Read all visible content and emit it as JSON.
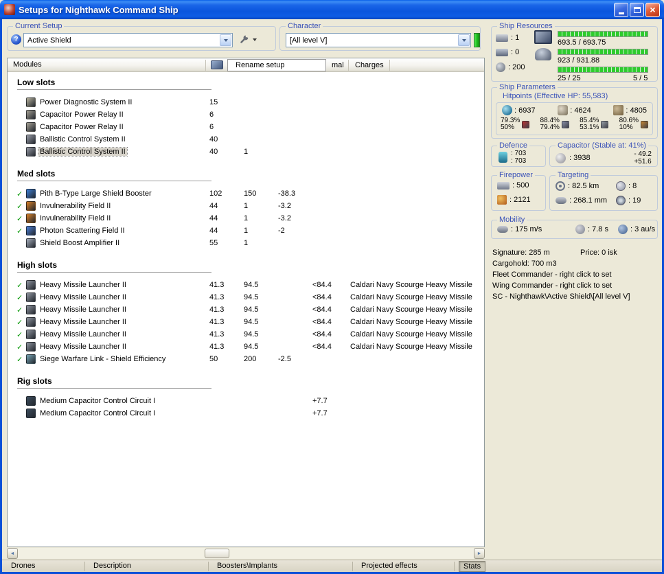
{
  "window": {
    "title": "Setups for Nighthawk Command Ship"
  },
  "setup": {
    "group_label": "Current Setup",
    "value": "Active Shield"
  },
  "character": {
    "group_label": "Character",
    "value": "[All level V]"
  },
  "menu": {
    "rename": "Rename setup"
  },
  "top_tabs": {
    "normal": "mal",
    "charges": "Charges"
  },
  "modules": {
    "header": "Modules",
    "sections": [
      {
        "title": "Low slots",
        "rows": [
          {
            "name": "Power Diagnostic System II",
            "c1": "15",
            "icon": "#aaa694"
          },
          {
            "name": "Capacitor Power Relay II",
            "c1": "6",
            "icon": "#9a968c"
          },
          {
            "name": "Capacitor Power Relay II",
            "c1": "6",
            "icon": "#9a968c"
          },
          {
            "name": "Ballistic Control System II",
            "c1": "40",
            "icon": "#8e929c"
          },
          {
            "name": "Ballistic Control System II",
            "c1": "40",
            "c2": "1",
            "icon": "#8e929c",
            "selected": true
          }
        ]
      },
      {
        "title": "Med slots",
        "rows": [
          {
            "check": true,
            "name": "Pith B-Type Large Shield Booster",
            "c1": "102",
            "c2": "150",
            "c3": "-38.3",
            "icon": "#3a78c8"
          },
          {
            "check": true,
            "name": "Invulnerability Field II",
            "c1": "44",
            "c2": "1",
            "c3": "-3.2",
            "icon": "#c87828"
          },
          {
            "check": true,
            "name": "Invulnerability Field II",
            "c1": "44",
            "c2": "1",
            "c3": "-3.2",
            "icon": "#c87828"
          },
          {
            "check": true,
            "name": "Photon Scattering Field II",
            "c1": "44",
            "c2": "1",
            "c3": "-2",
            "icon": "#4878c8"
          },
          {
            "name": "Shield Boost Amplifier II",
            "c1": "55",
            "c2": "1",
            "icon": "#9aa2b0"
          }
        ]
      },
      {
        "title": "High slots",
        "rows": [
          {
            "check": true,
            "name": "Heavy Missile Launcher II",
            "c1": "41.3",
            "c2": "94.5",
            "c4": "<84.4",
            "charge": "Caldari Navy Scourge Heavy Missile",
            "icon": "#858b95"
          },
          {
            "check": true,
            "name": "Heavy Missile Launcher II",
            "c1": "41.3",
            "c2": "94.5",
            "c4": "<84.4",
            "charge": "Caldari Navy Scourge Heavy Missile",
            "icon": "#858b95"
          },
          {
            "check": true,
            "name": "Heavy Missile Launcher II",
            "c1": "41.3",
            "c2": "94.5",
            "c4": "<84.4",
            "charge": "Caldari Navy Scourge Heavy Missile",
            "icon": "#858b95"
          },
          {
            "check": true,
            "name": "Heavy Missile Launcher II",
            "c1": "41.3",
            "c2": "94.5",
            "c4": "<84.4",
            "charge": "Caldari Navy Scourge Heavy Missile",
            "icon": "#858b95"
          },
          {
            "check": true,
            "name": "Heavy Missile Launcher II",
            "c1": "41.3",
            "c2": "94.5",
            "c4": "<84.4",
            "charge": "Caldari Navy Scourge Heavy Missile",
            "icon": "#858b95"
          },
          {
            "check": true,
            "name": "Heavy Missile Launcher II",
            "c1": "41.3",
            "c2": "94.5",
            "c4": "<84.4",
            "charge": "Caldari Navy Scourge Heavy Missile",
            "icon": "#858b95"
          },
          {
            "check": true,
            "name": "Siege Warfare Link - Shield Efficiency",
            "c1": "50",
            "c2": "200",
            "c3": "-2.5",
            "icon": "#6e99a8"
          }
        ]
      },
      {
        "title": "Rig slots",
        "rows": [
          {
            "name": "Medium Capacitor Control Circuit I",
            "c4": "+7.7",
            "icon": "#3a4a5a"
          },
          {
            "name": "Medium Capacitor Control Circuit I",
            "c4": "+7.7",
            "icon": "#3a4a5a"
          }
        ]
      }
    ]
  },
  "resources": {
    "group_label": "Ship Resources",
    "turrets": ": 1",
    "launchers": ": 0",
    "calibration": ": 200",
    "cpu_text": "693.5 / 693.75",
    "pg_text": "923 / 931.88",
    "upgrades": "25 / 25",
    "slots": "5 / 5"
  },
  "parameters": {
    "group_label": "Ship Parameters",
    "hitpoints_label": "Hitpoints (Effective HP: 55,583)",
    "shield": ": 6937",
    "armor": ": 4624",
    "hull": ": 4805",
    "resists": [
      {
        "top": "79.3%",
        "bottom": "50%",
        "color": "#c03434",
        "icon_name": "em-resist-icon"
      },
      {
        "top": "88.4%",
        "bottom": "79.4%",
        "color": "#8890a8",
        "icon_name": "explosive-resist-icon"
      },
      {
        "top": "85.4%",
        "bottom": "53.1%",
        "color": "#98a0a8",
        "icon_name": "kinetic-resist-icon"
      },
      {
        "top": "80.6%",
        "bottom": "10%",
        "color": "#c88834",
        "icon_name": "thermal-resist-icon"
      }
    ]
  },
  "defence": {
    "label": "Defence",
    "v1": ": 703",
    "v2": ": 703"
  },
  "capacitor": {
    "label": "Capacitor (Stable at: 41%)",
    "v1": ": 3938",
    "minus": "- 49.2",
    "plus": "+51.6"
  },
  "firepower": {
    "label": "Firepower",
    "v1": ": 500",
    "v2": ": 2121"
  },
  "targeting": {
    "label": "Targeting",
    "range": ": 82.5 km",
    "targets": ": 8",
    "scanres": ": 268.1 mm",
    "sensor": ": 19"
  },
  "mobility": {
    "label": "Mobility",
    "speed": ": 175 m/s",
    "align": ": 7.8 s",
    "warp": ": 3 au/s"
  },
  "info": {
    "signature": "Signature: 285 m",
    "price": "Price: 0 isk",
    "cargohold": "Cargohold: 700 m3",
    "fleet": "Fleet Commander - right click to set",
    "wing": "Wing Commander - right click to set",
    "path": "SC - Nighthawk\\Active Shield\\[All level V]"
  },
  "bottom_tabs": {
    "items": [
      "Drones",
      "Description",
      "Boosters\\Implants",
      "Projected effects",
      "Stats"
    ],
    "active": "Stats"
  }
}
